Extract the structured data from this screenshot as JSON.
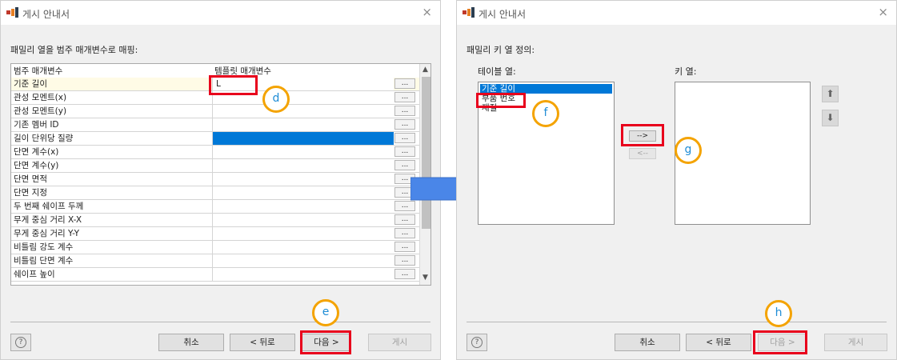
{
  "left_dialog": {
    "title": "게시 안내서",
    "close": "×",
    "heading": "패밀리 열을 범주 매개변수로 매핑:",
    "columns": {
      "name": "범주 매개변수",
      "value": "템플릿 매개변수"
    },
    "rows": [
      {
        "name": "기준 길이",
        "value": "L"
      },
      {
        "name": "관성 모멘트(x)",
        "value": ""
      },
      {
        "name": "관성 모멘트(y)",
        "value": ""
      },
      {
        "name": "기존 멤버 ID",
        "value": ""
      },
      {
        "name": "길이 단위당 질량",
        "value": ""
      },
      {
        "name": "단면 계수(x)",
        "value": ""
      },
      {
        "name": "단면 계수(y)",
        "value": ""
      },
      {
        "name": "단면 면적",
        "value": ""
      },
      {
        "name": "단면 지정",
        "value": ""
      },
      {
        "name": "두 번째 쉐이프 두께",
        "value": ""
      },
      {
        "name": "무게 중심 거리 X-X",
        "value": ""
      },
      {
        "name": "무게 중심 거리 Y-Y",
        "value": ""
      },
      {
        "name": "비틀림 강도 계수",
        "value": ""
      },
      {
        "name": "비틀림 단면 계수",
        "value": ""
      },
      {
        "name": "쉐이프 높이",
        "value": ""
      }
    ],
    "ellipsis": "...",
    "buttons": {
      "help": "?",
      "cancel": "취소",
      "back": "< 뒤로",
      "next": "다음 >",
      "publish": "게시"
    },
    "markers": {
      "d": "d",
      "e": "e"
    }
  },
  "right_dialog": {
    "title": "게시 안내서",
    "close": "×",
    "heading": "패밀리 키 열 정의:",
    "table_columns_label": "테이블 열:",
    "key_columns_label": "키 열:",
    "table_columns": [
      "기준 길이",
      "부품 번호",
      "재질"
    ],
    "selected_index": 0,
    "add_button": "-->",
    "remove_button": "<--",
    "buttons": {
      "help": "?",
      "cancel": "취소",
      "back": "< 뒤로",
      "next": "다음 >",
      "publish": "게시"
    },
    "markers": {
      "f": "f",
      "g": "g",
      "h": "h"
    }
  },
  "colors": {
    "selection": "#0078d7",
    "highlight_row": "#fffbe6",
    "callout_box": "#e8001c",
    "marker_ring": "#f4a300",
    "marker_text": "#1f8dd6",
    "flow_arrow": "#4a86e8"
  }
}
